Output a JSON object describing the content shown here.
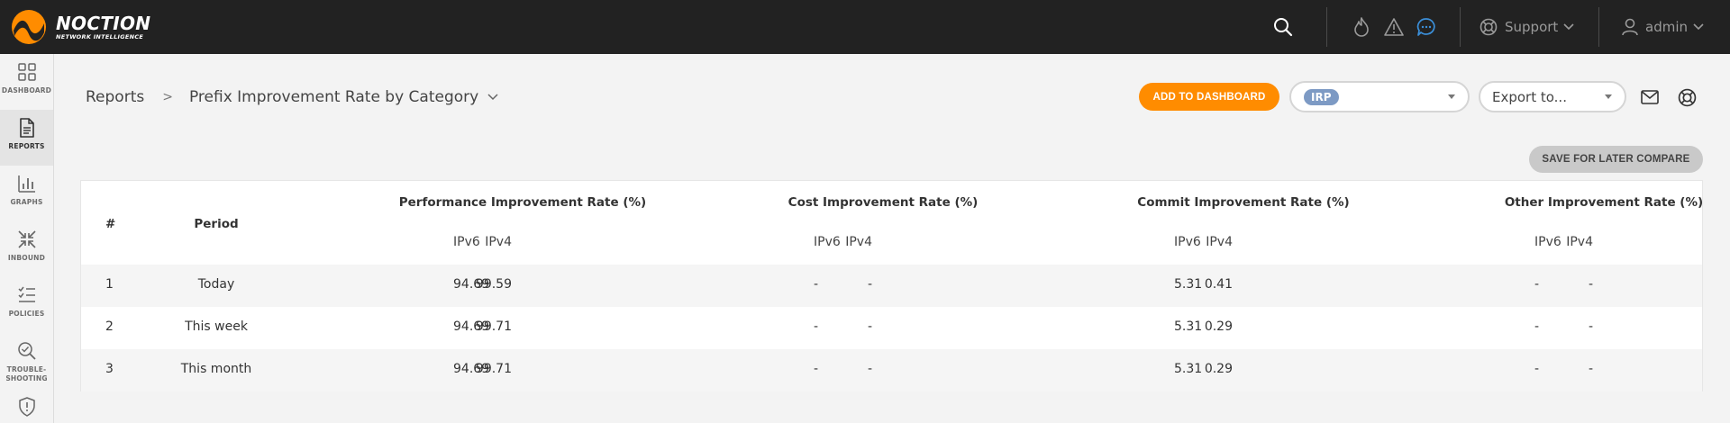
{
  "app": {
    "logo_name": "NOCTION",
    "logo_sub": "NETWORK INTELLIGENCE"
  },
  "topbar": {
    "icons": [
      "search-icon",
      "flame-icon",
      "warning-icon",
      "chat-icon"
    ],
    "support_label": "Support",
    "user_label": "admin"
  },
  "sidebar": {
    "items": [
      {
        "label": "DASHBOARD",
        "icon": "grid-icon"
      },
      {
        "label": "REPORTS",
        "icon": "document-icon",
        "active": true
      },
      {
        "label": "GRAPHS",
        "icon": "bar-chart-icon"
      },
      {
        "label": "INBOUND",
        "icon": "inbound-arrows-icon"
      },
      {
        "label": "POLICIES",
        "icon": "checklist-icon"
      },
      {
        "label": "TROUBLE-\nSHOOTING",
        "icon": "magnifier-check-icon"
      },
      {
        "label": "",
        "icon": "shield-icon"
      }
    ]
  },
  "breadcrumb": {
    "root": "Reports",
    "current": "Prefix Improvement Rate by Category"
  },
  "toolbar": {
    "add_to_dashboard": "ADD TO DASHBOARD",
    "provider_selected": "IRP",
    "export_placeholder": "Export to...",
    "save_for_later": "SAVE FOR LATER COMPARE"
  },
  "table": {
    "headers": {
      "index": "#",
      "period": "Period",
      "performance": "Performance Improvement Rate (%)",
      "cost": "Cost Improvement Rate (%)",
      "commit": "Commit Improvement Rate (%)",
      "other": "Other Improvement Rate (%)",
      "ipv4": "IPv4",
      "ipv6": "IPv6"
    },
    "rows": [
      {
        "index": "1",
        "period": "Today",
        "perf_v4": "99.59",
        "perf_v6": "94.69",
        "cost_v4": "-",
        "cost_v6": "-",
        "commit_v4": "0.41",
        "commit_v6": "5.31",
        "other_v4": "-",
        "other_v6": "-"
      },
      {
        "index": "2",
        "period": "This week",
        "perf_v4": "99.71",
        "perf_v6": "94.69",
        "cost_v4": "-",
        "cost_v6": "-",
        "commit_v4": "0.29",
        "commit_v6": "5.31",
        "other_v4": "-",
        "other_v6": "-"
      },
      {
        "index": "3",
        "period": "This month",
        "perf_v4": "99.71",
        "perf_v6": "94.69",
        "cost_v4": "-",
        "cost_v6": "-",
        "commit_v4": "0.29",
        "commit_v6": "5.31",
        "other_v4": "-",
        "other_v6": "-"
      }
    ]
  },
  "colors": {
    "topbar": "#222222",
    "accent_orange": "#ff8c00",
    "chat_blue": "#3b8fd9",
    "irp_badge": "#7d9ac4"
  }
}
